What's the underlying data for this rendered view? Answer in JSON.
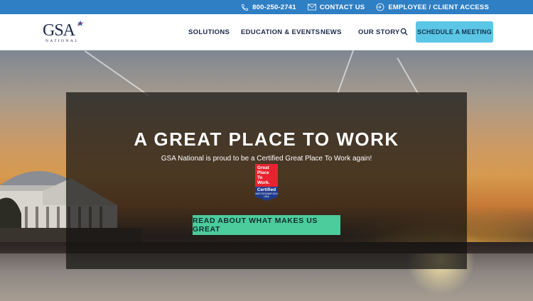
{
  "topbar": {
    "phone": "800-250-2741",
    "contact": "CONTACT US",
    "access": "EMPLOYEE / CLIENT ACCESS",
    "icons": [
      "phone-icon",
      "mail-icon",
      "login-icon"
    ],
    "background": "#2f7fc4"
  },
  "logo": {
    "text": "GSA",
    "subtext": "NATIONAL"
  },
  "nav": {
    "items": [
      "SOLUTIONS",
      "EDUCATION & EVENTS",
      "NEWS",
      "OUR STORY"
    ],
    "search_icon": "search-icon",
    "cta": "SCHEDULE A MEETING",
    "cta_color": "#5cc6e6"
  },
  "hero": {
    "headline": "A GREAT PLACE TO WORK",
    "subline": "GSA National is proud to be a Certified Great Place To Work again!",
    "badge": {
      "line1": "Great",
      "line2": "Place",
      "line3": "To",
      "line4": "Work.",
      "certified": "Certified",
      "dates": "MAR 2023-MAR 2024",
      "country": "USA"
    },
    "button": "READ ABOUT WHAT MAKES US GREAT",
    "button_color": "#4ccb9c"
  }
}
